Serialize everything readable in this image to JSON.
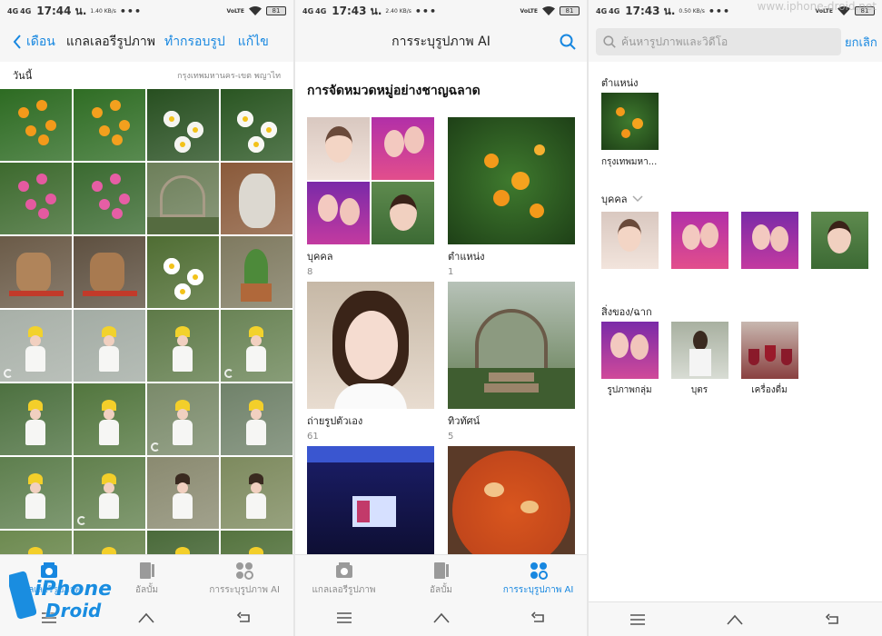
{
  "status_left": {
    "net": "4G",
    "net2": "4G",
    "dots": "•••"
  },
  "status_right": {
    "volte": "VoLTE",
    "battery": "81"
  },
  "gallery": {
    "time": "17:44 น.",
    "speed": "1.40 KB/s",
    "back_label": "เดือน",
    "title": "แกลเลอรีรูปภาพ",
    "edit_label": "ทำกรอบรูป",
    "edit2_label": "แก้ไข",
    "date_label": "วันนี้",
    "location_label": "กรุงเทพมหานคร-เขต พญาไท",
    "thumbs": [
      {
        "c1": "#2d6b22",
        "c2": "#f39a1a",
        "s": "flower"
      },
      {
        "c1": "#2f6d24",
        "c2": "#f3a01e",
        "s": "flower"
      },
      {
        "c1": "#274f20",
        "c2": "#f4f4f0",
        "s": "daisy"
      },
      {
        "c1": "#2a5622",
        "c2": "#f8f8f4",
        "s": "daisy"
      },
      {
        "c1": "#3d6a2e",
        "c2": "#e45aa0",
        "s": "flower"
      },
      {
        "c1": "#3a6a30",
        "c2": "#e65ea5",
        "s": "flower"
      },
      {
        "c1": "#6d7f5a",
        "c2": "#a79b86",
        "s": "arch"
      },
      {
        "c1": "#8a5a3a",
        "c2": "#dcd8d0",
        "s": "deer"
      },
      {
        "c1": "#6b5b48",
        "c2": "#b0845a",
        "s": "horse"
      },
      {
        "c1": "#5e5040",
        "c2": "#a87a50",
        "s": "horse"
      },
      {
        "c1": "#4f6d33",
        "c2": "#ffffff",
        "s": "daisy"
      },
      {
        "c1": "#7f7a60",
        "c2": "#4d8a3a",
        "s": "cactus"
      },
      {
        "c1": "#a8b0a8",
        "c2": "#f2d22c",
        "s": "person"
      },
      {
        "c1": "#a3aca4",
        "c2": "#f2d22c",
        "s": "person"
      },
      {
        "c1": "#5e7a48",
        "c2": "#f2d22c",
        "s": "person"
      },
      {
        "c1": "#6a8456",
        "c2": "#f2d22c",
        "s": "person"
      },
      {
        "c1": "#4d7140",
        "c2": "#f3cf2a",
        "s": "person"
      },
      {
        "c1": "#52763e",
        "c2": "#f3cf2a",
        "s": "person"
      },
      {
        "c1": "#7a8a6a",
        "c2": "#f3cf2a",
        "s": "person"
      },
      {
        "c1": "#70826a",
        "c2": "#f3cf2a",
        "s": "person"
      },
      {
        "c1": "#5e7f4e",
        "c2": "#f3cf2a",
        "s": "person"
      },
      {
        "c1": "#61804d",
        "c2": "#f3cf2a",
        "s": "person"
      },
      {
        "c1": "#8a8a70",
        "c2": "#3a2a20",
        "s": "person"
      },
      {
        "c1": "#7d8a5e",
        "c2": "#3a2a20",
        "s": "person"
      },
      {
        "c1": "#6d8a50",
        "c2": "#f3cf2a",
        "s": "person"
      },
      {
        "c1": "#6a8650",
        "c2": "#f3cf2a",
        "s": "person"
      },
      {
        "c1": "#4a6a3a",
        "c2": "#f3cf2a",
        "s": "person"
      },
      {
        "c1": "#55743f",
        "c2": "#f3cf2a",
        "s": "person"
      }
    ],
    "tabs": [
      {
        "label": "แกลเลอรีรูปภาพ"
      },
      {
        "label": "อัลบั้ม"
      },
      {
        "label": "การระบุรูปภาพ AI"
      }
    ]
  },
  "ai": {
    "time": "17:43 น.",
    "speed": "2.40 KB/s",
    "title": "การระบุรูปภาพ AI",
    "section_title": "การจัดหมวดหมู่อย่างชาญฉลาด",
    "cells": [
      {
        "label": "บุคคล",
        "count": "8"
      },
      {
        "label": "ตำแหน่ง",
        "count": "1"
      },
      {
        "label": "ถ่ายรูปตัวเอง",
        "count": "61"
      },
      {
        "label": "ทิวทัศน์",
        "count": "5"
      },
      {
        "label": "",
        "count": ""
      },
      {
        "label": "",
        "count": ""
      }
    ],
    "tabs": [
      {
        "label": "แกลเลอรีรูปภาพ"
      },
      {
        "label": "อัลบั้ม"
      },
      {
        "label": "การระบุรูปภาพ AI"
      }
    ]
  },
  "search": {
    "time": "17:43 น.",
    "speed": "0.50 KB/s",
    "placeholder": "ค้นหารูปภาพและวิดีโอ",
    "cancel_label": "ยกเลิก",
    "location_title": "ตำแหน่ง",
    "location_label": "กรุงเทพมหา...",
    "people_title": "บุคคล",
    "things_title": "สิ่งของ/ฉาก",
    "things": [
      {
        "label": "รูปภาพกลุ่ม"
      },
      {
        "label": "บุตร"
      },
      {
        "label": "เครื่องดื่ม"
      }
    ]
  },
  "watermark": {
    "line1": "iPhone",
    "line2": "Droid",
    "site": "www.iphone-droid.net"
  }
}
